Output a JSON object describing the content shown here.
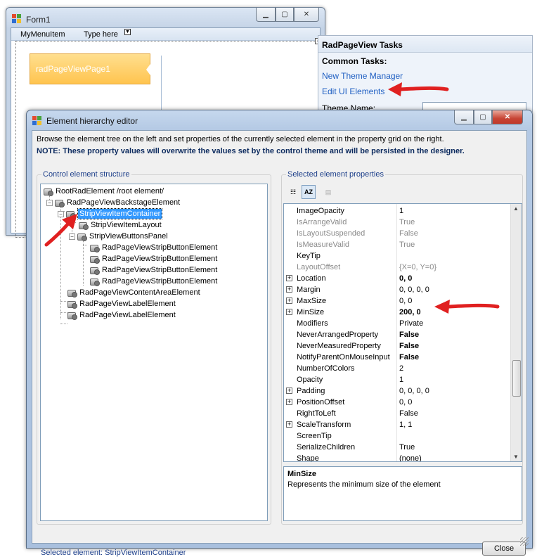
{
  "form": {
    "title": "Form1",
    "menu": {
      "item1": "MyMenuItem",
      "item2": "Type here"
    },
    "strip_button": "radPageViewPage1"
  },
  "tasks": {
    "header": "RadPageView Tasks",
    "common_tasks": "Common Tasks:",
    "new_theme_manager": "New Theme Manager",
    "edit_ui_elements": "Edit UI Elements",
    "theme_name": "Theme Name:"
  },
  "dialog": {
    "title": "Element hierarchy editor",
    "info": "Browse the element tree on the left and set properties of the currently selected element in the property grid on the right.",
    "note": "NOTE: These property values will overwrite the values set by the control theme and will be persisted in the designer.",
    "left_group": "Control element structure",
    "right_group": "Selected element properties",
    "tree": [
      {
        "label": "RootRadElement /root element/"
      },
      {
        "label": "RadPageViewBackstageElement"
      },
      {
        "label": "StripViewItemContainer"
      },
      {
        "label": "StripViewItemLayout"
      },
      {
        "label": "StripViewButtonsPanel"
      },
      {
        "label": "RadPageViewStripButtonElement"
      },
      {
        "label": "RadPageViewStripButtonElement"
      },
      {
        "label": "RadPageViewStripButtonElement"
      },
      {
        "label": "RadPageViewStripButtonElement"
      },
      {
        "label": "RadPageViewContentAreaElement"
      },
      {
        "label": "RadPageViewLabelElement"
      },
      {
        "label": "RadPageViewLabelElement"
      }
    ],
    "properties": [
      {
        "name": "ImageOpacity",
        "value": "1"
      },
      {
        "name": "IsArrangeValid",
        "value": "True"
      },
      {
        "name": "IsLayoutSuspended",
        "value": "False"
      },
      {
        "name": "IsMeasureValid",
        "value": "True"
      },
      {
        "name": "KeyTip",
        "value": ""
      },
      {
        "name": "LayoutOffset",
        "value": "{X=0, Y=0}"
      },
      {
        "name": "Location",
        "value": "0, 0"
      },
      {
        "name": "Margin",
        "value": "0, 0, 0, 0"
      },
      {
        "name": "MaxSize",
        "value": "0, 0"
      },
      {
        "name": "MinSize",
        "value": "200, 0"
      },
      {
        "name": "Modifiers",
        "value": "Private"
      },
      {
        "name": "NeverArrangedProperty",
        "value": "False"
      },
      {
        "name": "NeverMeasuredProperty",
        "value": "False"
      },
      {
        "name": "NotifyParentOnMouseInput",
        "value": "False"
      },
      {
        "name": "NumberOfColors",
        "value": "2"
      },
      {
        "name": "Opacity",
        "value": "1"
      },
      {
        "name": "Padding",
        "value": "0, 0, 0, 0"
      },
      {
        "name": "PositionOffset",
        "value": "0, 0"
      },
      {
        "name": "RightToLeft",
        "value": "False"
      },
      {
        "name": "ScaleTransform",
        "value": "1, 1"
      },
      {
        "name": "ScreenTip",
        "value": ""
      },
      {
        "name": "SerializeChildren",
        "value": "True"
      },
      {
        "name": "Shape",
        "value": "(none)"
      }
    ],
    "description_title": "MinSize",
    "description_text": "Represents the minimum size of the element",
    "status": "Selected element: StripViewItemContainer",
    "close": "Close"
  },
  "colors": {
    "accent_selection": "#3399ff",
    "arrow": "#e02020",
    "link": "#1e5ec2"
  }
}
